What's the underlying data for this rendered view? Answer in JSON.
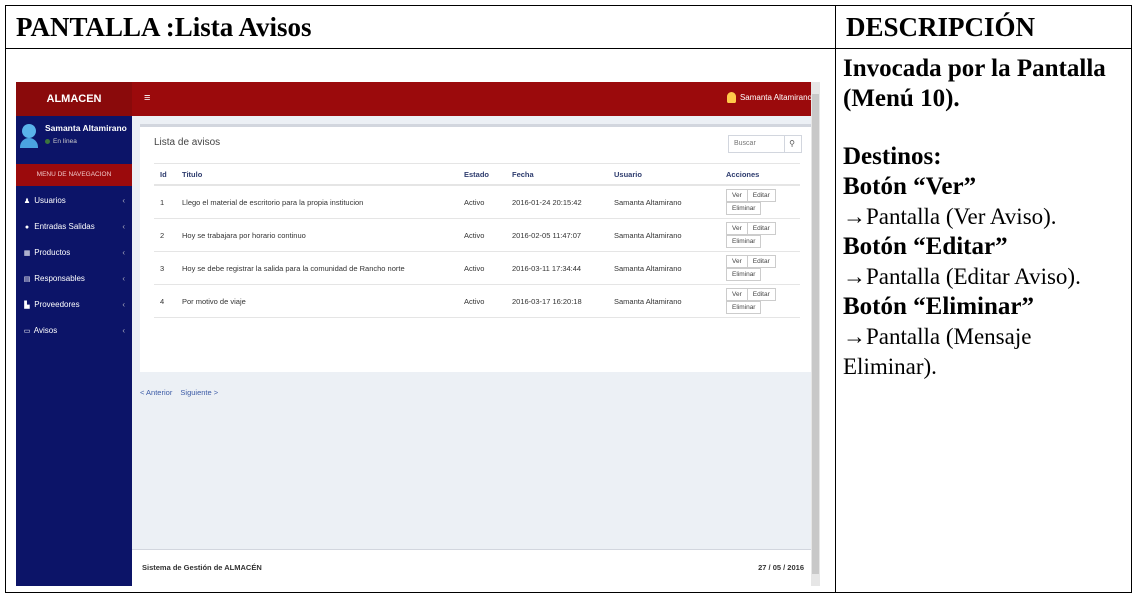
{
  "doc": {
    "header_left": "PANTALLA :Lista Avisos",
    "header_right": "DESCRIPCIÓN",
    "invoked": "Invocada por la Pantalla (Menú 10).",
    "destinos": "Destinos:",
    "ver_btn": "Botón “Ver”",
    "ver_dest": "→Pantalla (Ver Aviso).",
    "editar_btn": "Botón “Editar”",
    "editar_dest": "→Pantalla (Editar Aviso).",
    "eliminar_btn": "Botón “Eliminar”",
    "eliminar_dest": "→Pantalla (Mensaje Eliminar)."
  },
  "app": {
    "brand": "ALMACEN",
    "menu_icon": "≡",
    "top_user": "Samanta Altamirano",
    "sidebar": {
      "user_name": "Samanta Altamirano",
      "status": "En línea",
      "nav_header": "MENU DE NAVEGACION",
      "items": [
        {
          "label": "Usuarios",
          "icon": "users-icon"
        },
        {
          "label": "Entradas Salidas",
          "icon": "globe-icon"
        },
        {
          "label": "Productos",
          "icon": "table-icon"
        },
        {
          "label": "Responsables",
          "icon": "card-icon"
        },
        {
          "label": "Proveedores",
          "icon": "building-icon"
        },
        {
          "label": "Avisos",
          "icon": "monitor-icon"
        }
      ]
    },
    "box_title": "Lista de avisos",
    "search_placeholder": "Buscar",
    "columns": [
      "Id",
      "Titulo",
      "Estado",
      "Fecha",
      "Usuario",
      "Acciones"
    ],
    "rows": [
      {
        "id": "1",
        "titulo": "Llego el material de escritorio para la propia institucion",
        "estado": "Activo",
        "fecha": "2016-01-24 20:15:42",
        "usuario": "Samanta Altamirano"
      },
      {
        "id": "2",
        "titulo": "Hoy se trabajara por horario continuo",
        "estado": "Activo",
        "fecha": "2016-02-05 11:47:07",
        "usuario": "Samanta Altamirano"
      },
      {
        "id": "3",
        "titulo": "Hoy se debe registrar la salida para la comunidad de Rancho norte",
        "estado": "Activo",
        "fecha": "2016-03-11 17:34:44",
        "usuario": "Samanta Altamirano"
      },
      {
        "id": "4",
        "titulo": "Por motivo de viaje",
        "estado": "Activo",
        "fecha": "2016-03-17 16:20:18",
        "usuario": "Samanta Altamirano"
      }
    ],
    "actions": {
      "ver": "Ver",
      "editar": "Editar",
      "eliminar": "Eliminar"
    },
    "pager": {
      "prev": "< Anterior",
      "next": "Siguiente >"
    },
    "footer_left": "Sistema de Gestión de ALMACÉN",
    "footer_right": "27 / 05 / 2016"
  }
}
